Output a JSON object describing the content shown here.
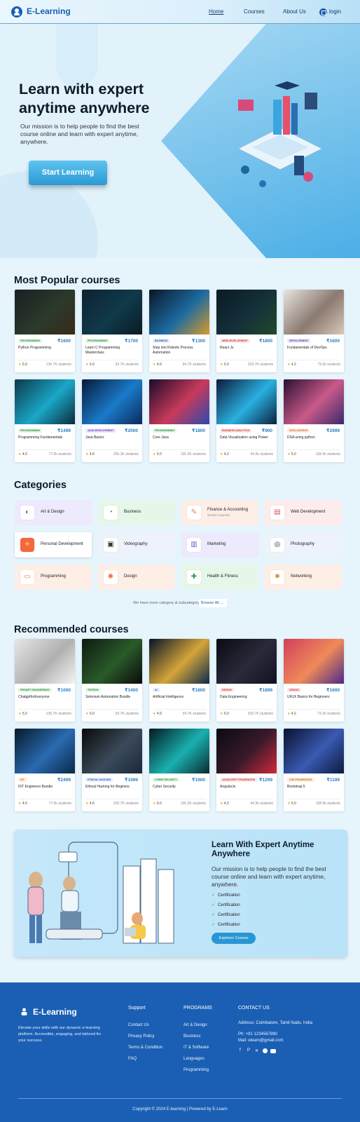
{
  "header": {
    "brand": "E-Learning",
    "nav": [
      "Home",
      "Courses",
      "About Us"
    ],
    "login": "login"
  },
  "hero": {
    "title": "Learn with expert anytime anywhere",
    "subtitle": "Our mission is to help people to find the best course online and learn with expert anytime, anywhere.",
    "cta": "Start Learning"
  },
  "popular": {
    "title": "Most Popular courses",
    "courses": [
      {
        "tag": "PROGRAMMING",
        "price": "₹1600",
        "name": "Python Programming",
        "rating": "5.0",
        "students": "135.7K students"
      },
      {
        "tag": "PROGRAMMING",
        "price": "₹1700",
        "name": "Learn C Programming Masterclass",
        "rating": "5.0",
        "students": "93.7K students"
      },
      {
        "tag": "BUSINESS",
        "price": "₹1300",
        "name": "Step into Robotic Process Automation",
        "rating": "4.9",
        "students": "94.7K students"
      },
      {
        "tag": "WEB DEVELOPMENT",
        "price": "₹1800",
        "name": "React Js",
        "rating": "5.0",
        "students": "203.7K students"
      },
      {
        "tag": "DEVELOPMENT",
        "price": "₹1600",
        "name": "Fundamentals of DevOps",
        "rating": "4.2",
        "students": "73.2k students"
      },
      {
        "tag": "PROGRAMMING",
        "price": "₹1499",
        "name": "Programming Fundamentals",
        "rating": "4.0",
        "students": "77.6k students"
      },
      {
        "tag": "JAVA DEVELOPMENT",
        "price": "₹2000",
        "name": "Java Basics",
        "rating": "4.6",
        "students": "205.3K students"
      },
      {
        "tag": "PROGRAMMING",
        "price": "₹1800",
        "name": "Core Java",
        "rating": "5.0",
        "students": "100.2K students"
      },
      {
        "tag": "BUSINESS ANALYTICS",
        "price": "₹900",
        "name": "Data Visualization using Power",
        "rating": "4.2",
        "students": "44.3k students"
      },
      {
        "tag": "DATA SCIENCE",
        "price": "₹2999",
        "name": "DSA using python",
        "rating": "5.0",
        "students": "158.9k students"
      }
    ]
  },
  "categories": {
    "title": "Categories",
    "items": [
      {
        "label": "Art & Design",
        "sub": ""
      },
      {
        "label": "Business",
        "sub": ""
      },
      {
        "label": "Finance & Accounting",
        "sub": "33,841 Courses"
      },
      {
        "label": "Web Development",
        "sub": ""
      },
      {
        "label": "Personal Development",
        "sub": ""
      },
      {
        "label": "Videography",
        "sub": ""
      },
      {
        "label": "Marketing",
        "sub": ""
      },
      {
        "label": "Photography",
        "sub": ""
      },
      {
        "label": "Programming",
        "sub": ""
      },
      {
        "label": "Design",
        "sub": ""
      },
      {
        "label": "Health & Fitness",
        "sub": ""
      },
      {
        "label": "Networking",
        "sub": ""
      }
    ],
    "note": "We have more category & subcategory.",
    "browse": "Browse All"
  },
  "recommended": {
    "title": "Recommended courses",
    "courses": [
      {
        "tag": "PROMPT ENGINEERING",
        "price": "₹1000",
        "name": "ChatgptforEveryone",
        "rating": "5.0",
        "students": "135.7K students"
      },
      {
        "tag": "TESTING",
        "price": "₹1400",
        "name": "Selenium Automation Bundle",
        "rating": "5.0",
        "students": "93.7K students"
      },
      {
        "tag": "AI",
        "price": "₹1800",
        "name": "Artificial Intelligence",
        "rating": "4.9",
        "students": "94.7K students"
      },
      {
        "tag": "DESIGN",
        "price": "₹1899",
        "name": "Data Engineering",
        "rating": "5.0",
        "students": "203.7K students"
      },
      {
        "tag": "DESIGN",
        "price": "₹1600",
        "name": "UI/UX Basics for Beginners",
        "rating": "4.2",
        "students": "73.2k students"
      },
      {
        "tag": "IOT",
        "price": "₹2499",
        "name": "IOT Engineers Bundle",
        "rating": "4.0",
        "students": "77.6k students"
      },
      {
        "tag": "ETHICAL HACKING",
        "price": "₹1999",
        "name": "Ethical Hacking for Beginers",
        "rating": "4.6",
        "students": "203.7K students"
      },
      {
        "tag": "CYBER SECURITY",
        "price": "₹1900",
        "name": "Cyber Security",
        "rating": "5.0",
        "students": "100.2K students"
      },
      {
        "tag": "JAVASCRIPT FRAMEWORK",
        "price": "₹1299",
        "name": "AngularJs",
        "rating": "4.2",
        "students": "44.3k students"
      },
      {
        "tag": "CSS FRAMEWORK",
        "price": "₹1199",
        "name": "Bootstrap 5",
        "rating": "5.0",
        "students": "158.9k students"
      }
    ]
  },
  "promo": {
    "title": "Learn With Expert Anytime Anywhere",
    "text": "Our mission is to help people to find the best course online and learn with expert anytime, anywhere.",
    "items": [
      "Certification",
      "Certification",
      "Certification",
      "Certification"
    ],
    "cta": "Explorer Course"
  },
  "footer": {
    "brand": "E-Learning",
    "desc": "Elevate your skills with our dynamic e-learning platform. Accessible, engaging, and tailored for your success.",
    "support": {
      "title": "Support",
      "links": [
        "Contact Us",
        "Privacy Policy",
        "Terms & Condition",
        "FAQ"
      ]
    },
    "programs": {
      "title": "PROGRAMS",
      "links": [
        "Art & Design",
        "Business",
        "IT & Software",
        "Languages",
        "Programming"
      ]
    },
    "contact": {
      "title": "CONTACT US",
      "address": "Address: Coimbatore, Tamil Nadu, India",
      "phone": "Ph: +91 1234567890",
      "mail": "Mail: elearn@gmail.com"
    },
    "copyright": "Copyright © 2024 E-learning | Powered by E-Learn"
  },
  "colors": {
    "brand": "#1a5fb4",
    "accent": "#2896d4",
    "rating_star": "#f4a321"
  }
}
